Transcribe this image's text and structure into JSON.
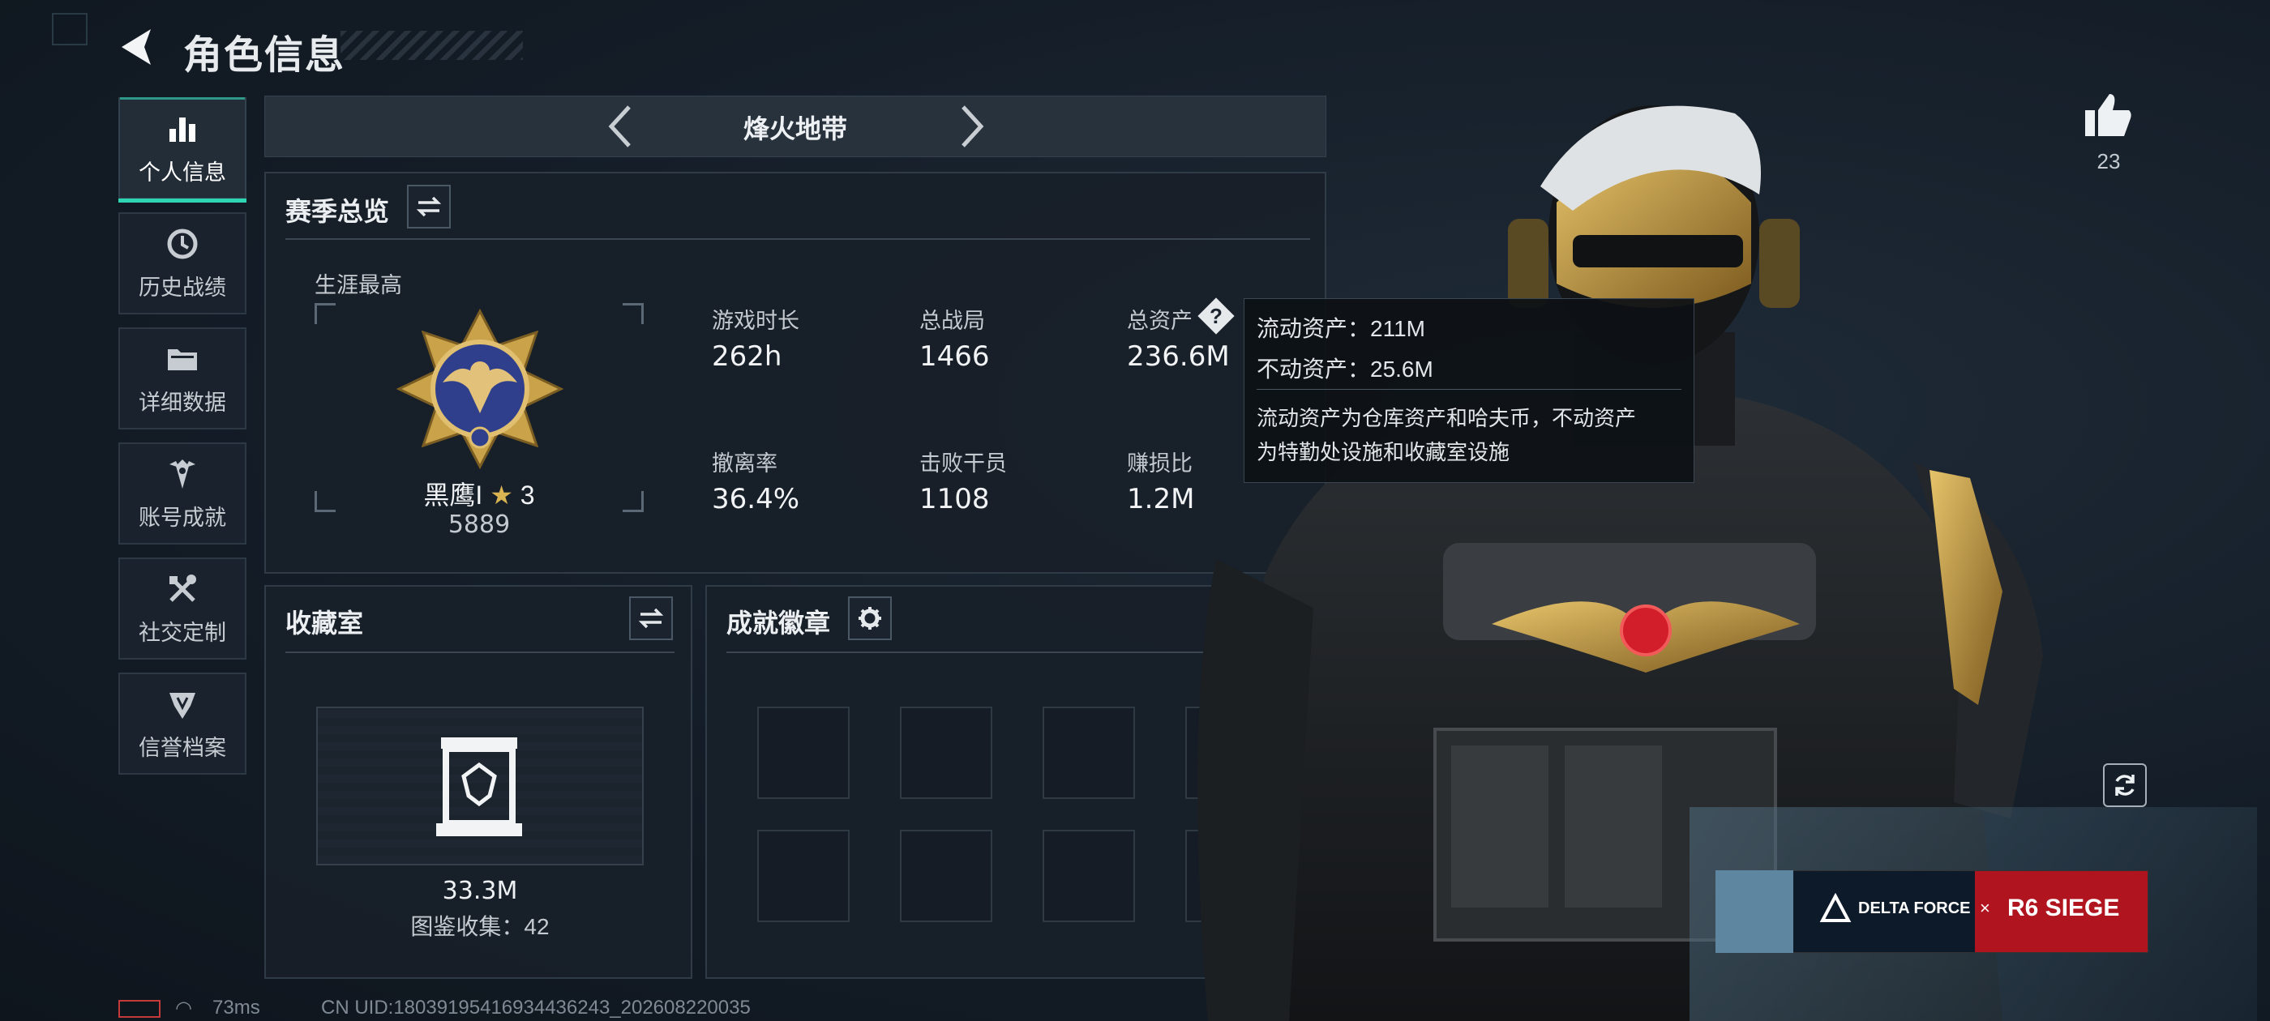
{
  "header": {
    "title": "角色信息"
  },
  "sidebar": {
    "items": [
      {
        "label": "个人信息",
        "icon": "bar-chart-icon",
        "active": true
      },
      {
        "label": "历史战绩",
        "icon": "history-icon"
      },
      {
        "label": "详细数据",
        "icon": "folder-icon"
      },
      {
        "label": "账号成就",
        "icon": "achievement-icon"
      },
      {
        "label": "社交定制",
        "icon": "tools-icon"
      },
      {
        "label": "信誉档案",
        "icon": "credit-icon"
      }
    ]
  },
  "mode": {
    "label": "烽火地带"
  },
  "season": {
    "title": "赛季总览",
    "career_label": "生涯最高",
    "rank_name": "黑鹰I",
    "rank_stars": "3",
    "rank_score": "5889",
    "stats": [
      {
        "label": "游戏时长",
        "value": "262h"
      },
      {
        "label": "总战局",
        "value": "1466"
      },
      {
        "label": "总资产",
        "value": "236.6M"
      },
      {
        "label": "撤离率",
        "value": "36.4%"
      },
      {
        "label": "击败干员",
        "value": "1108"
      },
      {
        "label": "赚损比",
        "value": "1.2M"
      }
    ]
  },
  "tooltip": {
    "liquid": "流动资产：211M",
    "fixed": "不动资产：25.6M",
    "desc_1": "流动资产为仓库资产和哈夫币，不动资产",
    "desc_2": "为特勤处设施和收藏室设施"
  },
  "collection": {
    "title": "收藏室",
    "value": "33.3M",
    "count": "图鉴收集：42"
  },
  "badges": {
    "title": "成就徽章"
  },
  "likes": {
    "count": "23"
  },
  "banner": {
    "brand1": "DELTA FORCE",
    "x": "×",
    "brand2": "R6 SIEGE"
  },
  "status": {
    "ping": "73ms",
    "uid": "CN UID:18039195416934436243_202608220035"
  },
  "colors": {
    "accent": "#2fd6b4",
    "gold": "#c9a24a",
    "rose": "#d21d2b"
  }
}
